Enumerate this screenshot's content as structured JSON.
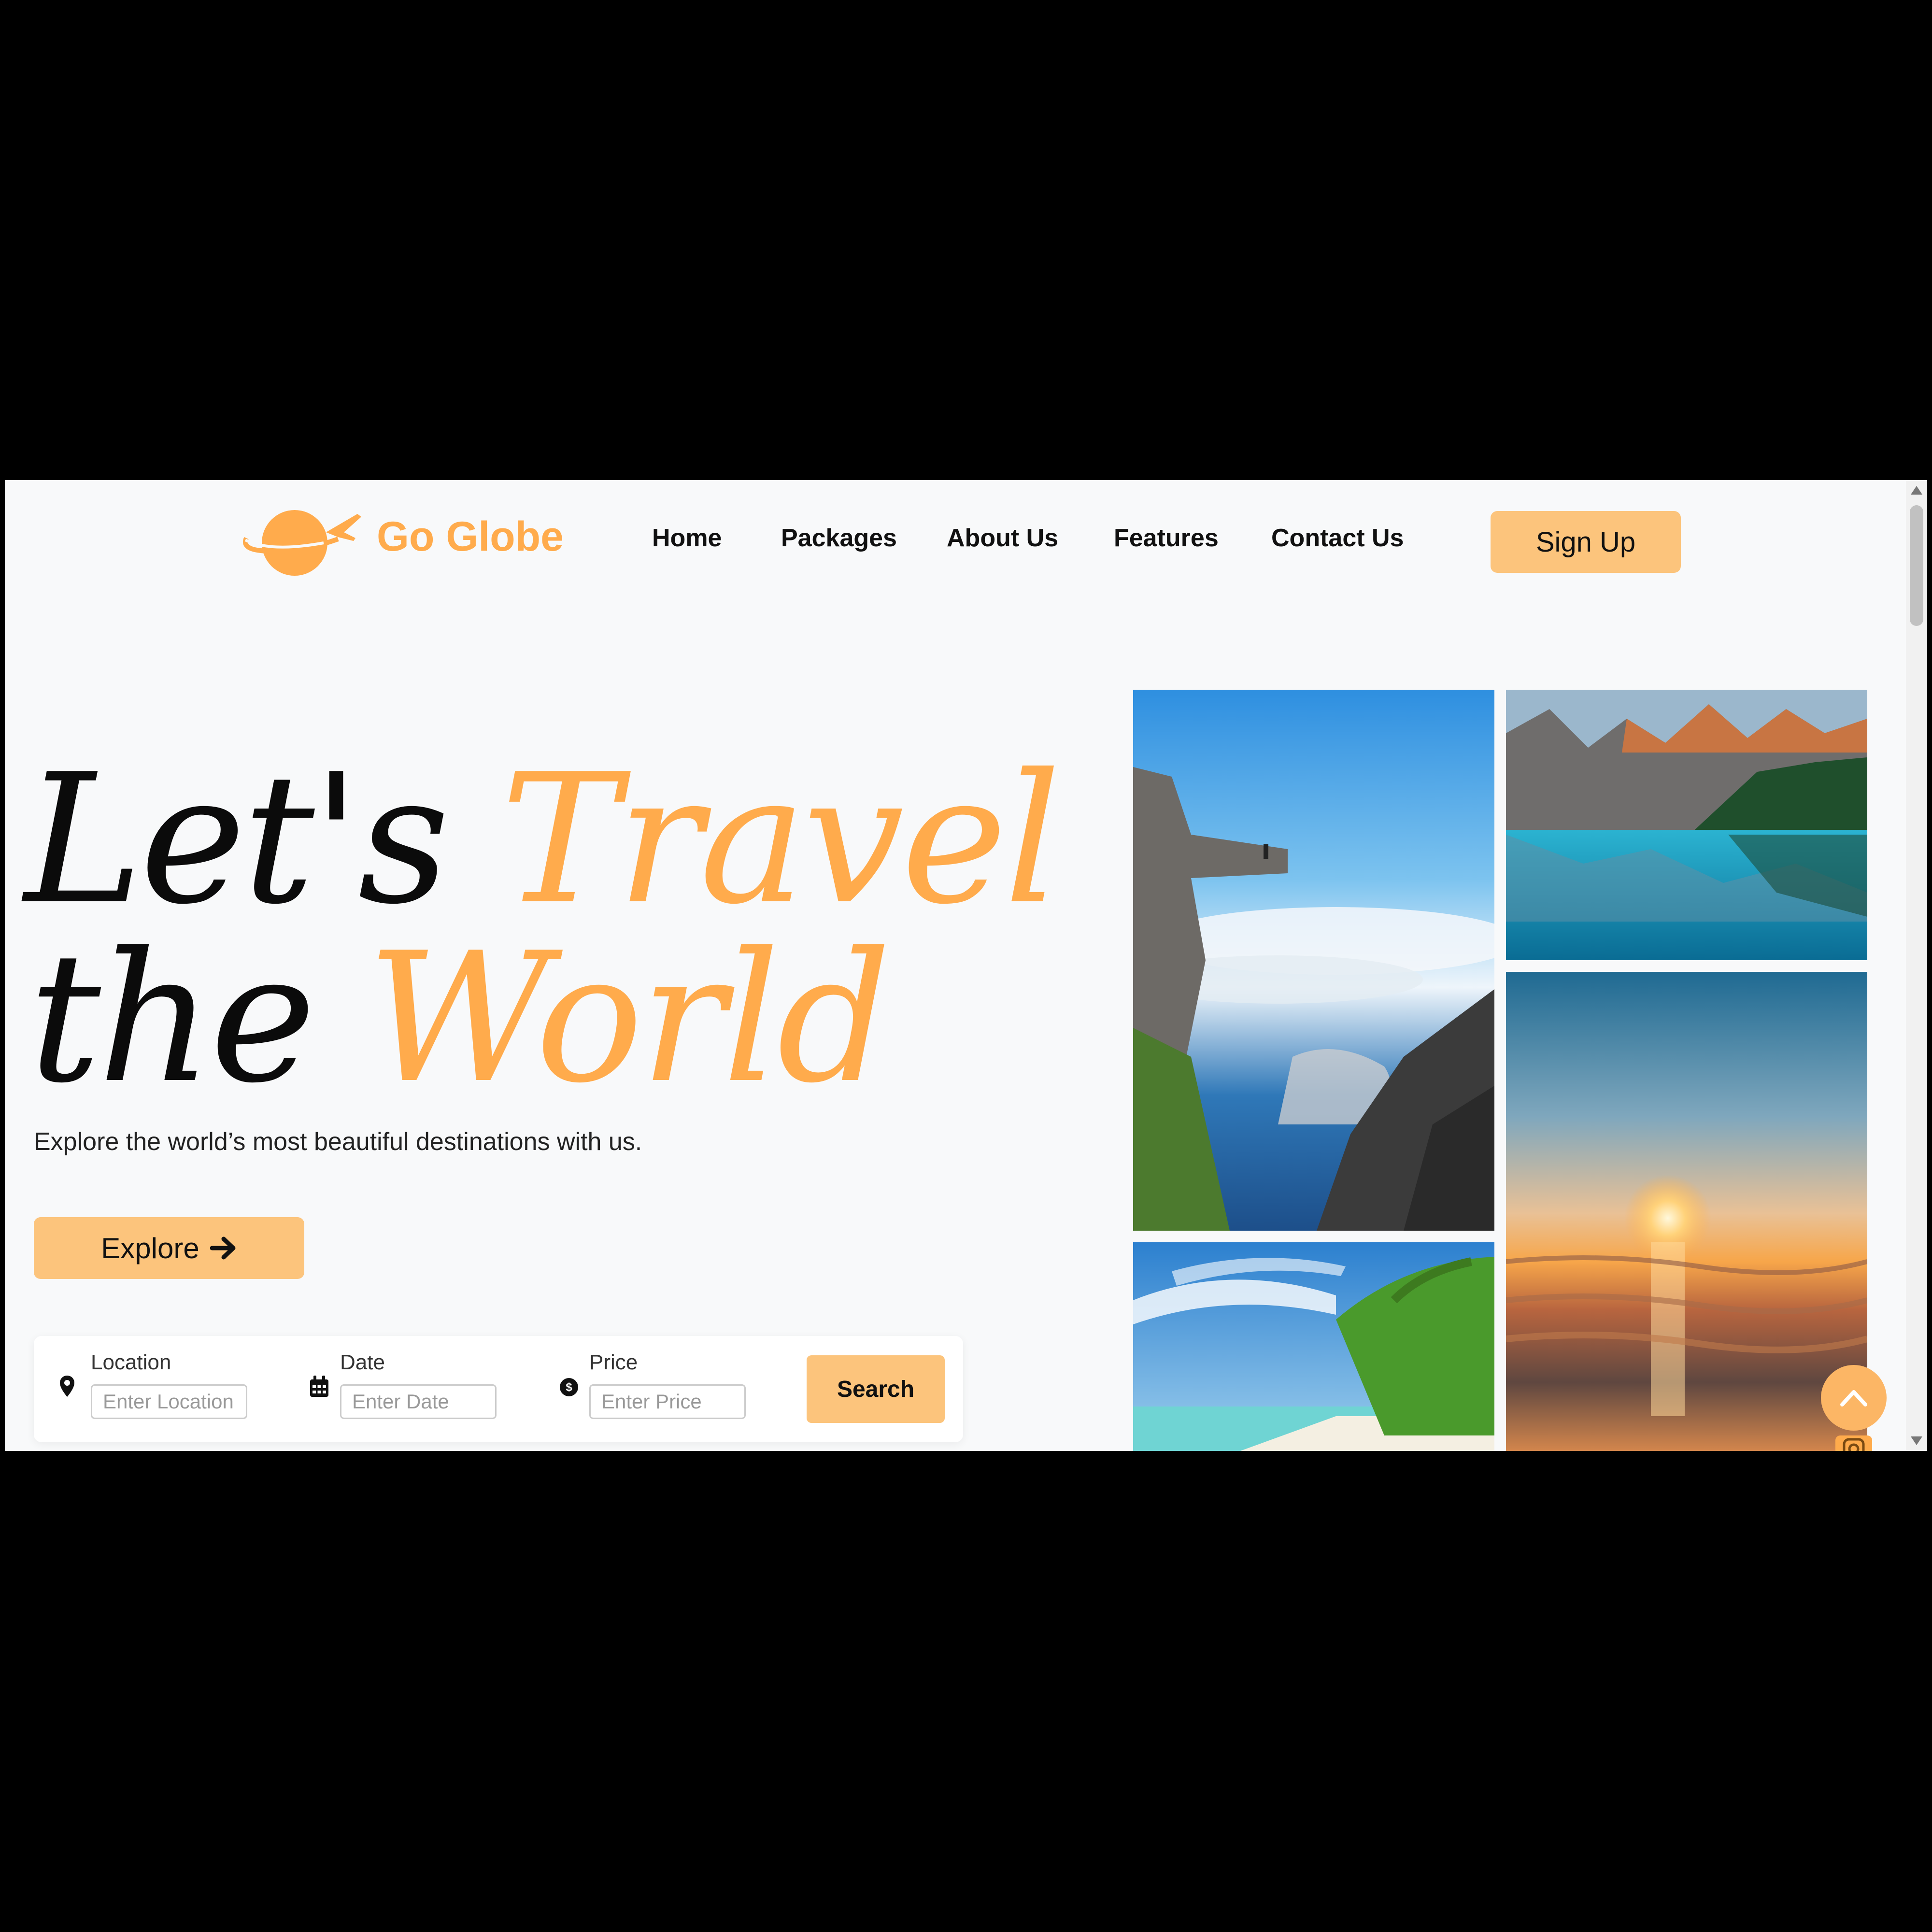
{
  "brand": {
    "name": "Go Globe",
    "logo_icon": "globe-plane-icon"
  },
  "nav": {
    "items": [
      "Home",
      "Packages",
      "About Us",
      "Features",
      "Contact Us"
    ],
    "signup_label": "Sign Up"
  },
  "hero": {
    "line1_a": "Let's",
    "line1_b": "Travel",
    "line2_a": "the",
    "line2_b": "World",
    "subtitle": "Explore the world’s most beautiful destinations with us.",
    "explore_label": "Explore"
  },
  "search": {
    "location_label": "Location",
    "location_placeholder": "Enter Location",
    "date_label": "Date",
    "date_placeholder": "Enter Date",
    "price_label": "Price",
    "price_placeholder": "Enter Price",
    "button_label": "Search"
  },
  "gallery": [
    "cliff-over-clouds",
    "mountain-lake",
    "tropical-beach",
    "ocean-sunset"
  ],
  "colors": {
    "accent": "#ffab4c",
    "button": "#fcc47c",
    "background": "#f8f9fa"
  }
}
